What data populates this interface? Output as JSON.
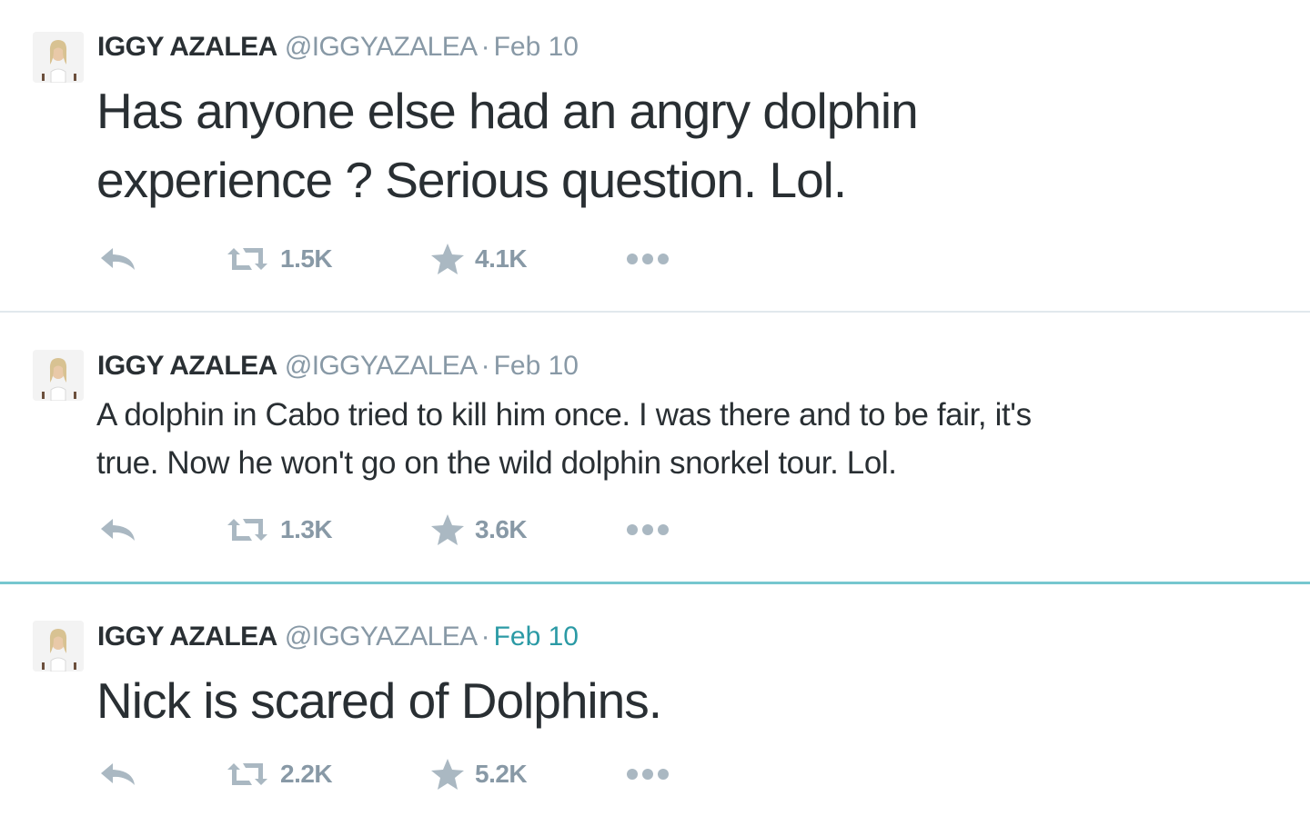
{
  "colors": {
    "text": "#292f33",
    "muted": "#8899a6",
    "icon": "#aab8c2",
    "time_active": "#2b9aa5",
    "separator": "#e1e8ed",
    "separator_active": "#76c7cf"
  },
  "tweets": [
    {
      "fullname": "IGGY AZALEA",
      "username": "@IGGYAZALEA",
      "separator": "·",
      "time": "Feb 10",
      "text_lines": [
        "Has anyone else had an angry dolphin",
        "experience ? Serious question. Lol."
      ],
      "retweets": "1.5K",
      "favorites": "4.1K",
      "icons": [
        "reply-icon",
        "retweet-icon",
        "star-icon",
        "more-icon"
      ]
    },
    {
      "fullname": "IGGY AZALEA",
      "username": "@IGGYAZALEA",
      "separator": "·",
      "time": "Feb 10",
      "text_lines": [
        "A dolphin in Cabo tried to kill him once. I was there and to be fair, it's",
        "true. Now he won't go on the wild dolphin snorkel tour. Lol."
      ],
      "retweets": "1.3K",
      "favorites": "3.6K",
      "icons": [
        "reply-icon",
        "retweet-icon",
        "star-icon",
        "more-icon"
      ]
    },
    {
      "fullname": "IGGY AZALEA",
      "username": "@IGGYAZALEA",
      "separator": "·",
      "time": "Feb 10",
      "text_lines": [
        "Nick is scared of Dolphins."
      ],
      "retweets": "2.2K",
      "favorites": "5.2K",
      "icons": [
        "reply-icon",
        "retweet-icon",
        "star-icon",
        "more-icon"
      ]
    }
  ]
}
